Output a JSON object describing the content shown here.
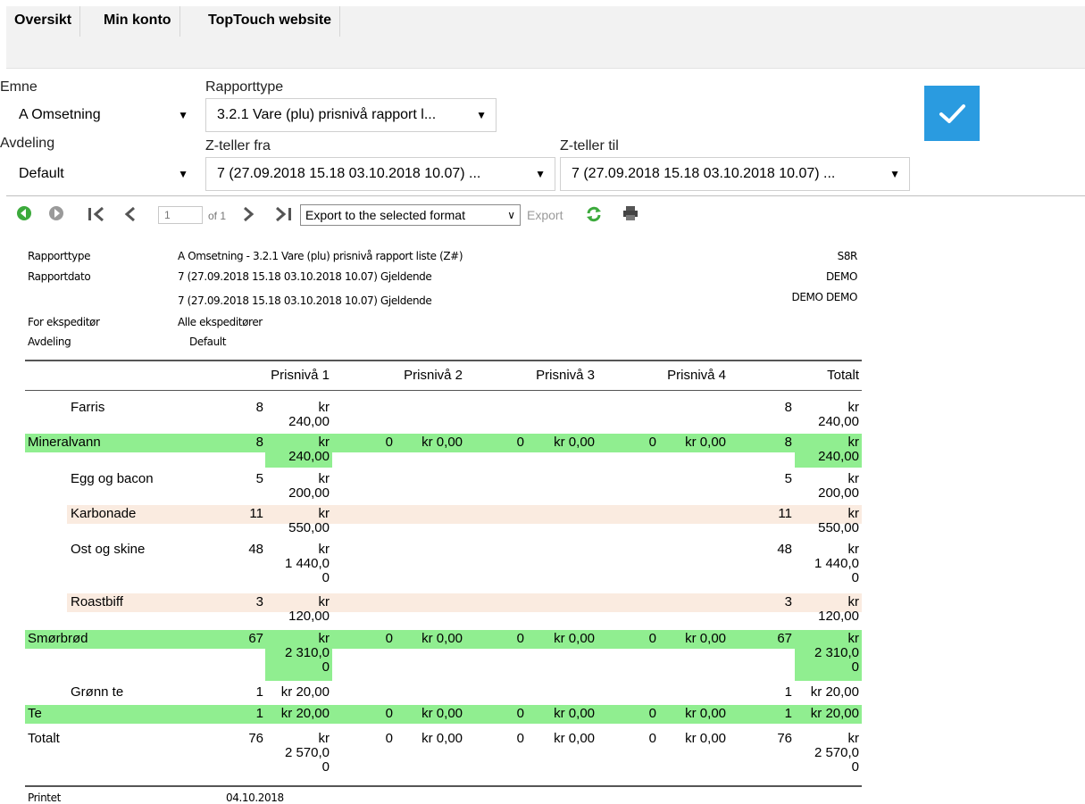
{
  "nav": {
    "items": [
      "Oversikt",
      "Min konto",
      "TopTouch website"
    ]
  },
  "filters": {
    "emne_label": "Emne",
    "emne_value": "A Omsetning",
    "rapporttype_label": "Rapporttype",
    "rapporttype_value": "3.2.1 Vare (plu) prisnivå rapport l...",
    "avdeling_label": "Avdeling",
    "avdeling_value": "Default",
    "zfra_label": "Z-teller fra",
    "zfra_value": "7 (27.09.2018 15.18 03.10.2018 10.07) ...",
    "ztil_label": "Z-teller til",
    "ztil_value": "7 (27.09.2018 15.18 03.10.2018 10.07) ..."
  },
  "toolbar": {
    "page_value": "1",
    "of_text": "of 1",
    "export_format": "Export to the selected format",
    "export_label": "Export"
  },
  "colors": {
    "accent": "#2a9be0",
    "group_row": "#90ee90",
    "alt_row": "#faebe0"
  },
  "report": {
    "header": {
      "rapporttype_label": "Rapporttype",
      "rapporttype_value": "A Omsetning - 3.2.1 Vare (plu) prisnivå rapport liste (Z#)",
      "rapportdato_label": "Rapportdato",
      "rapportdato_value1": "7 (27.09.2018 15.18 03.10.2018 10.07) Gjeldende",
      "rapportdato_value2": "7 (27.09.2018 15.18 03.10.2018 10.07) Gjeldende",
      "ekspeditor_label": "For ekspeditør",
      "ekspeditor_value": "Alle ekspeditører",
      "avdeling_label": "Avdeling",
      "avdeling_value": "Default",
      "right1": "S8R",
      "right2": "DEMO",
      "right3": "DEMO DEMO"
    },
    "columns": [
      "Prisnivå 1",
      "Prisnivå 2",
      "Prisnivå 3",
      "Prisnivå 4",
      "Totalt"
    ],
    "rows": [
      {
        "name": "Farris",
        "type": "item",
        "p1q": "8",
        "p1a": "kr\n240,00",
        "p2q": "",
        "p2a": "",
        "p3q": "",
        "p3a": "",
        "p4q": "",
        "p4a": "",
        "tq": "8",
        "ta": "kr\n240,00"
      },
      {
        "name": "Mineralvann",
        "type": "group",
        "p1q": "8",
        "p1a": "kr\n240,00",
        "p2q": "0",
        "p2a": "kr 0,00",
        "p3q": "0",
        "p3a": "kr 0,00",
        "p4q": "0",
        "p4a": "kr 0,00",
        "tq": "8",
        "ta": "kr\n240,00"
      },
      {
        "name": "Egg og bacon",
        "type": "item",
        "p1q": "5",
        "p1a": "kr\n200,00",
        "p2q": "",
        "p2a": "",
        "p3q": "",
        "p3a": "",
        "p4q": "",
        "p4a": "",
        "tq": "5",
        "ta": "kr\n200,00"
      },
      {
        "name": "Karbonade",
        "type": "alt",
        "p1q": "11",
        "p1a": "kr\n550,00",
        "p2q": "",
        "p2a": "",
        "p3q": "",
        "p3a": "",
        "p4q": "",
        "p4a": "",
        "tq": "11",
        "ta": "kr\n550,00"
      },
      {
        "name": "Ost og skine",
        "type": "item",
        "p1q": "48",
        "p1a": "kr\n1 440,0\n0",
        "p2q": "",
        "p2a": "",
        "p3q": "",
        "p3a": "",
        "p4q": "",
        "p4a": "",
        "tq": "48",
        "ta": "kr\n1 440,0\n0"
      },
      {
        "name": "Roastbiff",
        "type": "alt",
        "p1q": "3",
        "p1a": "kr\n120,00",
        "p2q": "",
        "p2a": "",
        "p3q": "",
        "p3a": "",
        "p4q": "",
        "p4a": "",
        "tq": "3",
        "ta": "kr\n120,00"
      },
      {
        "name": "Smørbrød",
        "type": "group",
        "p1q": "67",
        "p1a": "kr\n2 310,0\n0",
        "p2q": "0",
        "p2a": "kr 0,00",
        "p3q": "0",
        "p3a": "kr 0,00",
        "p4q": "0",
        "p4a": "kr 0,00",
        "tq": "67",
        "ta": "kr\n2 310,0\n0"
      },
      {
        "name": "Grønn te",
        "type": "item",
        "p1q": "1",
        "p1a": "kr 20,00",
        "p2q": "",
        "p2a": "",
        "p3q": "",
        "p3a": "",
        "p4q": "",
        "p4a": "",
        "tq": "1",
        "ta": "kr 20,00"
      },
      {
        "name": "Te",
        "type": "group",
        "p1q": "1",
        "p1a": "kr 20,00",
        "p2q": "0",
        "p2a": "kr 0,00",
        "p3q": "0",
        "p3a": "kr 0,00",
        "p4q": "0",
        "p4a": "kr 0,00",
        "tq": "1",
        "ta": "kr 20,00"
      },
      {
        "name": "Totalt",
        "type": "total",
        "p1q": "76",
        "p1a": "kr\n2 570,0\n0",
        "p2q": "0",
        "p2a": "kr 0,00",
        "p3q": "0",
        "p3a": "kr 0,00",
        "p4q": "0",
        "p4a": "kr 0,00",
        "tq": "76",
        "ta": "kr\n2 570,0\n0"
      }
    ],
    "footer": {
      "printet_label": "Printet",
      "printet_value": "04.10.2018"
    }
  }
}
